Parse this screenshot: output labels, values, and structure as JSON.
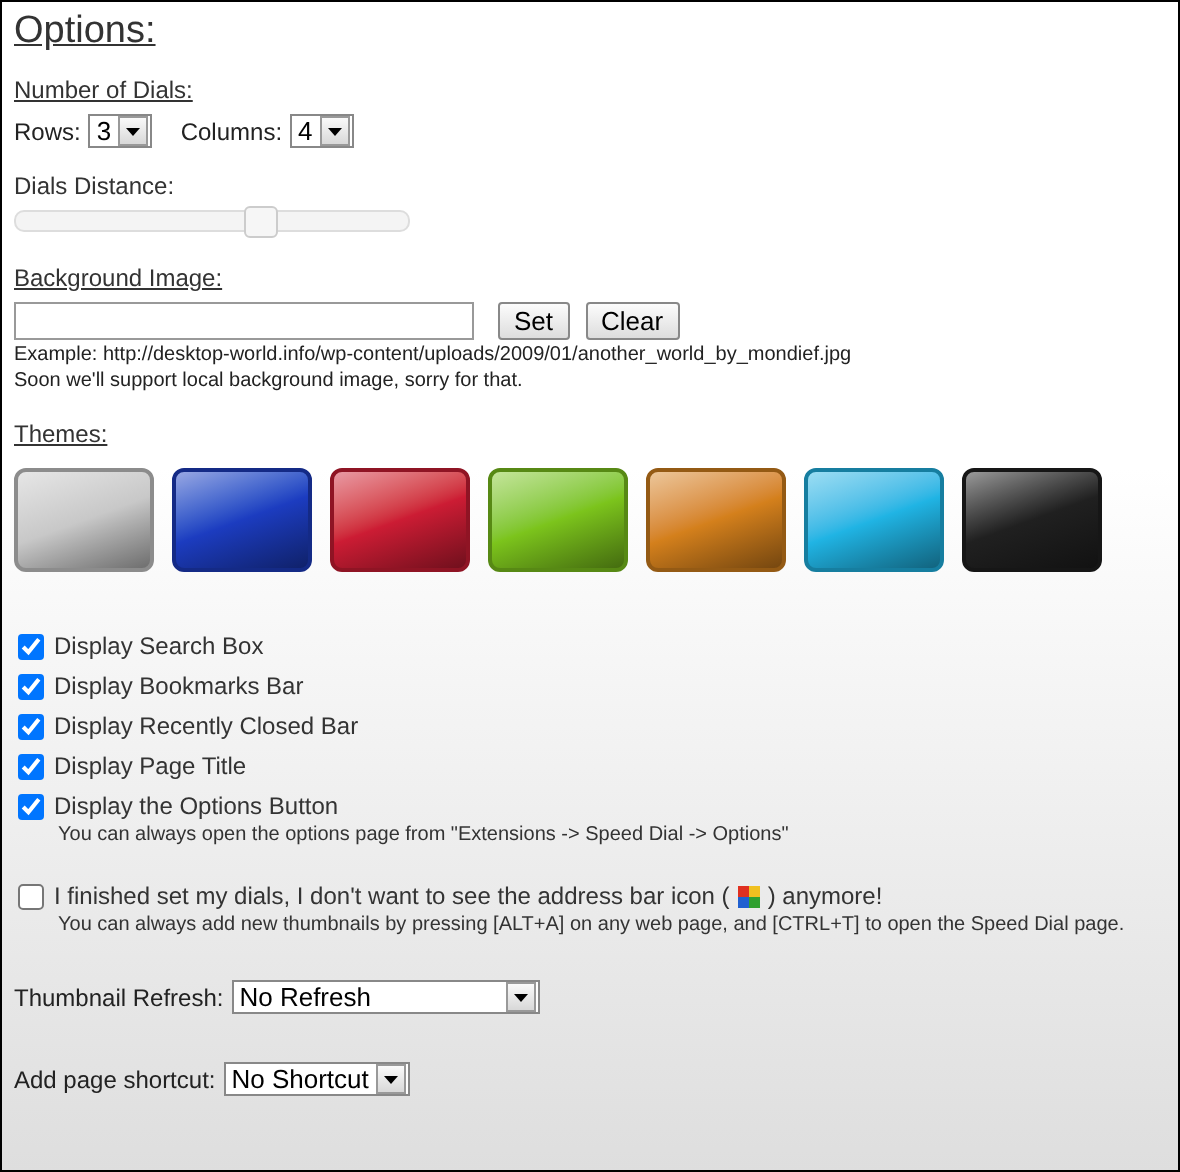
{
  "title": "Options:",
  "dials": {
    "heading": "Number of Dials:",
    "rows_label": "Rows:",
    "rows": "3",
    "columns_label": "Columns:",
    "columns": "4"
  },
  "distance": {
    "label": "Dials Distance:",
    "level": 0.62
  },
  "background": {
    "heading": "Background Image:",
    "buttons": [
      "Set",
      "Clear"
    ],
    "notes": [
      "Example: http://desktop-world.info/wp-content/uploads/2009/01/another_world_by_mondief.jpg",
      "Soon we'll support local background image, sorry for that."
    ]
  },
  "themes": {
    "heading": "Themes:",
    "items": [
      {
        "color": "#c8c8c8"
      },
      {
        "color": "#1c3cc0"
      },
      {
        "color": "#cc1c34"
      },
      {
        "color": "#7cc41c"
      },
      {
        "color": "#d4801c"
      },
      {
        "color": "#20b4e4"
      },
      {
        "color": "#202020"
      }
    ]
  },
  "checks": [
    {
      "kind": "plain",
      "label": "Display Search Box",
      "checked": true
    },
    {
      "kind": "plain",
      "label": "Display Bookmarks Bar",
      "checked": true
    },
    {
      "kind": "plain",
      "label": "Display Recently Closed Bar",
      "checked": true
    },
    {
      "kind": "plain",
      "label": "Display Page Title",
      "checked": true
    },
    {
      "kind": "plain",
      "label": "Display the Options Button",
      "checked": true,
      "hint": "You can always open the options page from \"Extensions -> Speed Dial -> Options\""
    },
    {
      "kind": "with-icon",
      "label": "I finished set my dials, I don't want to see the address bar icon (",
      "label_after": ") anymore!",
      "checked": false,
      "hint": "You can always add new thumbnails by pressing [ALT+A] on any web page, and [CTRL+T] to open the Speed Dial page."
    }
  ],
  "selects": [
    {
      "label": "Thumbnail Refresh:",
      "value": "No Refresh",
      "kind": "wide"
    },
    {
      "label": "Add page shortcut:",
      "value": "No Shortcut",
      "kind": "narrow"
    }
  ]
}
